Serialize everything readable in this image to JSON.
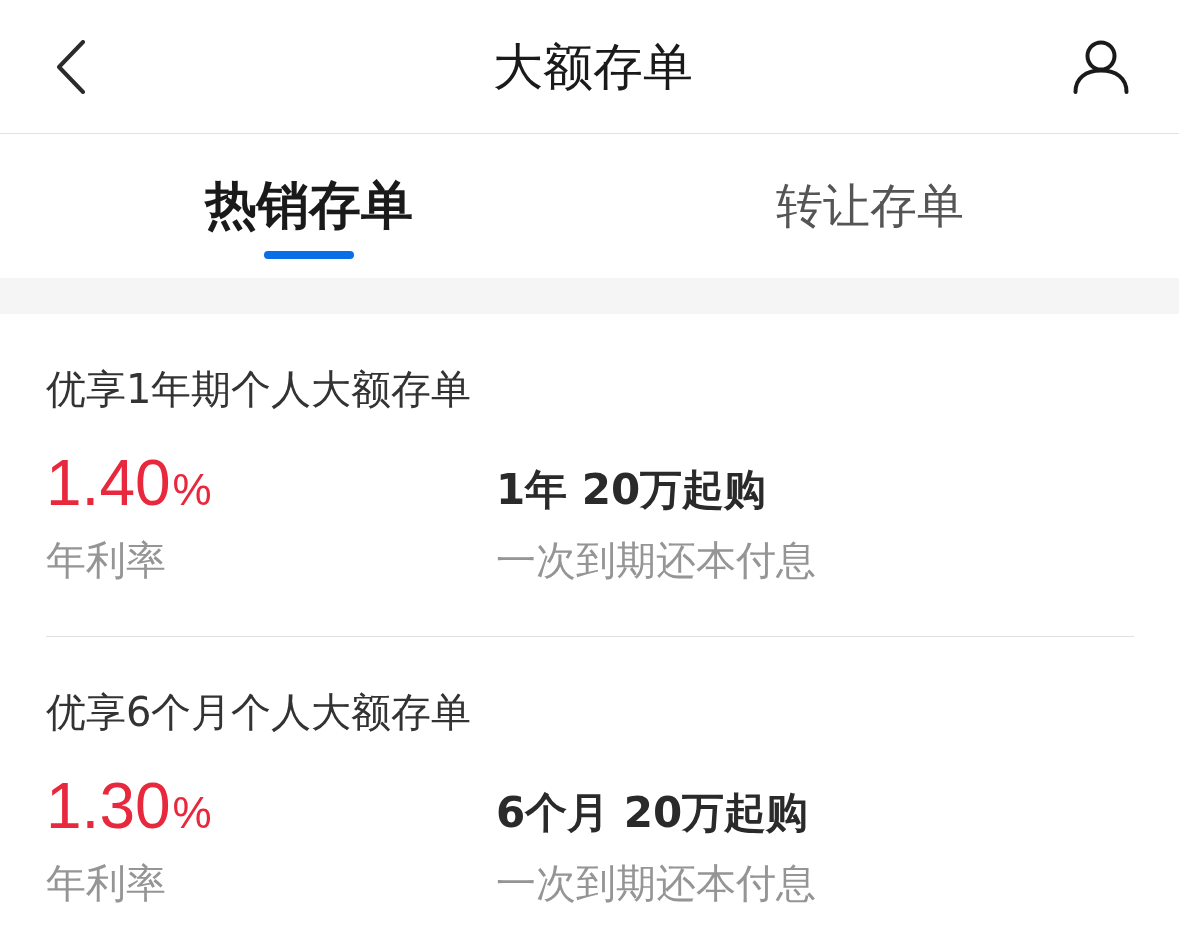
{
  "header": {
    "title": "大额存单"
  },
  "tabs": [
    {
      "label": "热销存单",
      "selected": true
    },
    {
      "label": "转让存单",
      "selected": false
    }
  ],
  "products": [
    {
      "name": "优享1年期个人大额存单",
      "rate": "1.40",
      "rate_unit": "%",
      "rate_label": "年利率",
      "terms": "1年 20万起购",
      "repayment": "一次到期还本付息"
    },
    {
      "name": "优享6个月个人大额存单",
      "rate": "1.30",
      "rate_unit": "%",
      "rate_label": "年利率",
      "terms": "6个月 20万起购",
      "repayment": "一次到期还本付息"
    }
  ]
}
